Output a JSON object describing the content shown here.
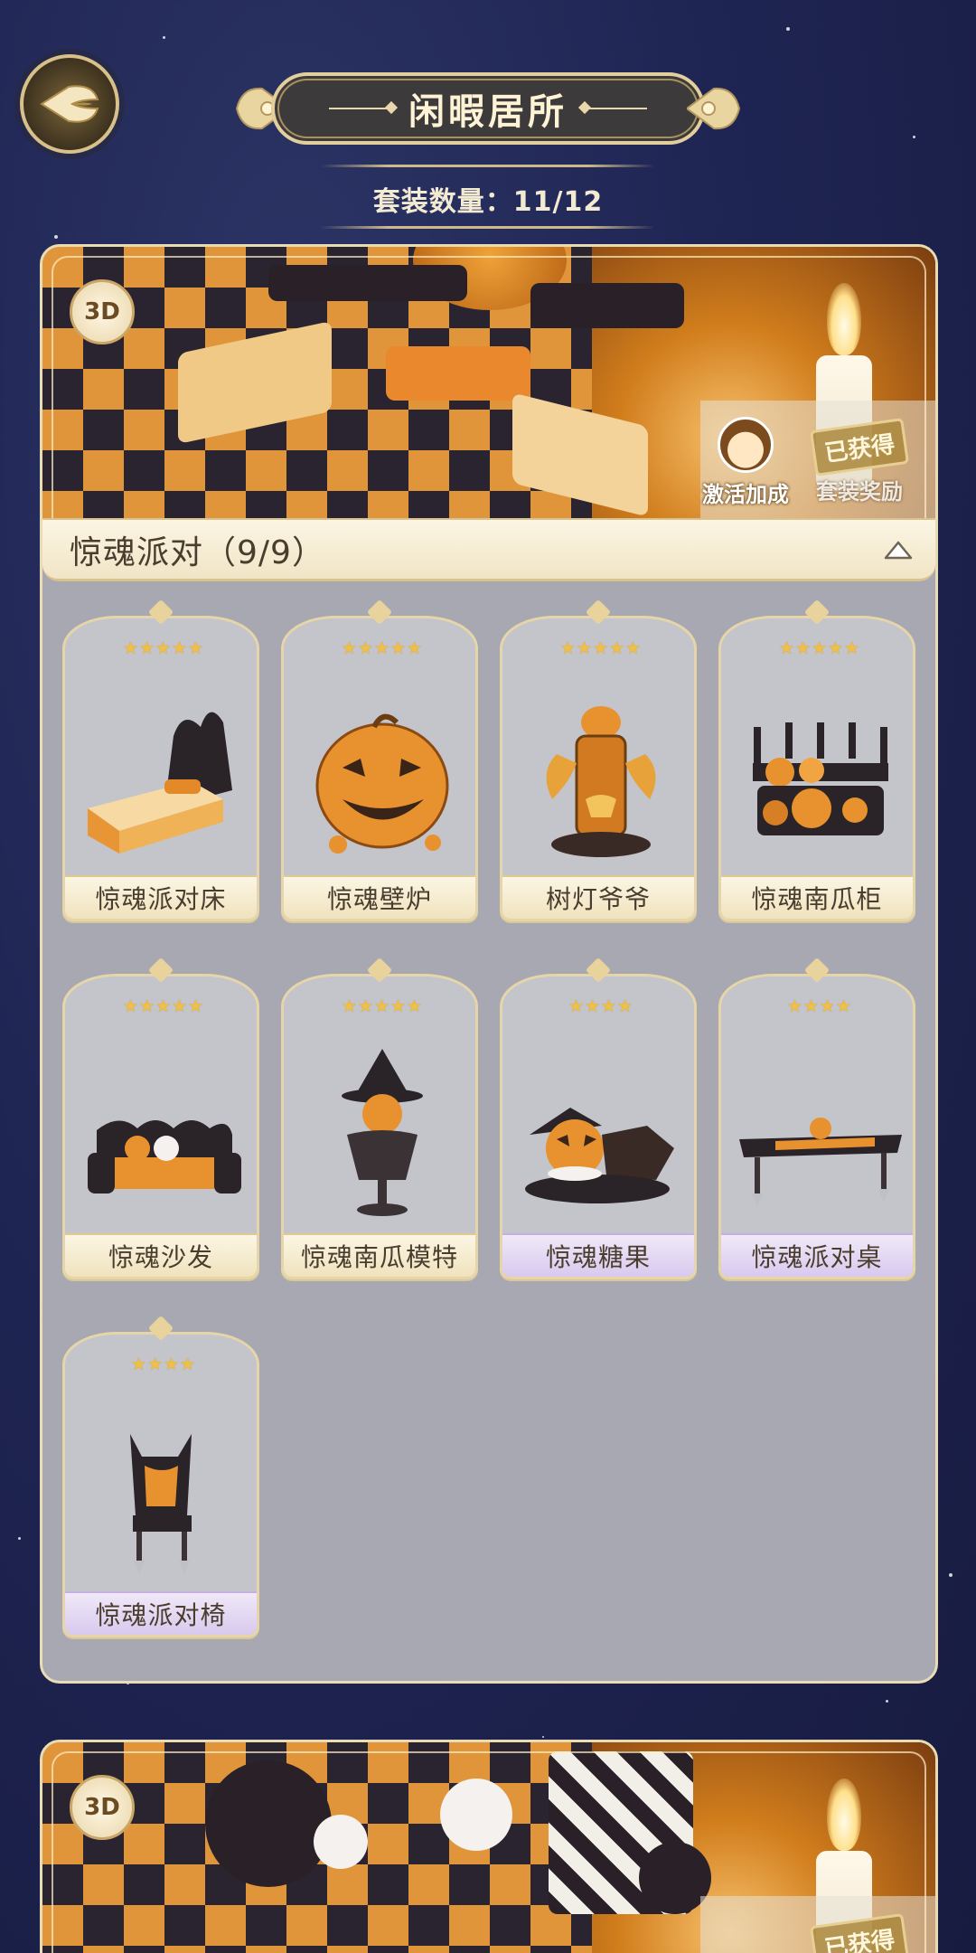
{
  "header": {
    "back_icon": "wing-back-icon",
    "title": "闲暇居所",
    "set_count_label": "套装数量：11/12"
  },
  "colors": {
    "background": "#1f2553",
    "panel": "#a8a8b3",
    "gold": "#e3cf9d",
    "star": "#f0c046",
    "purple_label": "#d8c9ee"
  },
  "sets": [
    {
      "badge": "3D",
      "activate_label": "激活加成",
      "reward_stamp": "已获得",
      "reward_label": "套装奖励",
      "name": "惊魂派对（9/9）",
      "expanded": true,
      "items": [
        {
          "name": "惊魂派对床",
          "stars": "★★★★★",
          "label_style": "gold"
        },
        {
          "name": "惊魂壁炉",
          "stars": "★★★★★",
          "label_style": "gold"
        },
        {
          "name": "树灯爷爷",
          "stars": "★★★★★",
          "label_style": "gold"
        },
        {
          "name": "惊魂南瓜柜",
          "stars": "★★★★★",
          "label_style": "gold"
        },
        {
          "name": "惊魂沙发",
          "stars": "★★★★★",
          "label_style": "gold"
        },
        {
          "name": "惊魂南瓜模特",
          "stars": "★★★★★",
          "label_style": "gold"
        },
        {
          "name": "惊魂糖果",
          "stars": "★★★★",
          "label_style": "purple"
        },
        {
          "name": "惊魂派对桌",
          "stars": "★★★★",
          "label_style": "purple"
        },
        {
          "name": "惊魂派对椅",
          "stars": "★★★★",
          "label_style": "purple"
        }
      ]
    },
    {
      "badge": "3D",
      "reward_stamp": "已获得"
    }
  ]
}
